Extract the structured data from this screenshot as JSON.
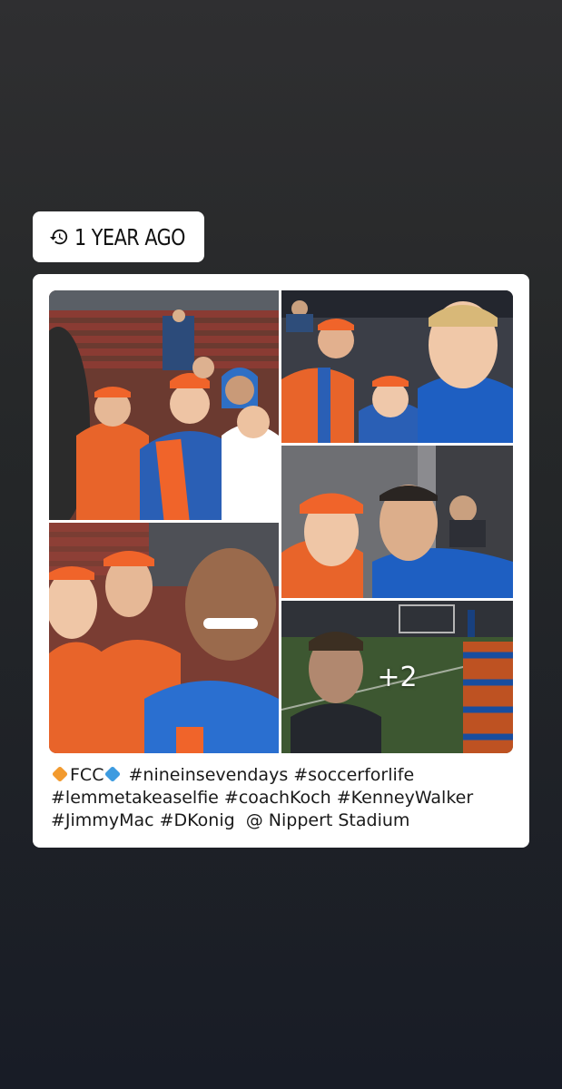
{
  "memory": {
    "label": "1 YEAR AGO",
    "icon": "history-icon"
  },
  "post": {
    "extra_photos_label": "+2",
    "caption": {
      "line1_prefix": "",
      "line1_team": "FCC",
      "line1_rest": " #nineinsevendays #soccerforlife",
      "line2": "#lemmetakeaselfie #coachKoch #KenneyWalker",
      "line3": "#JimmyMac #DKonig  @ Nippert Stadium"
    },
    "emoji": {
      "orange_diamond": "orange-diamond-icon",
      "blue_diamond": "blue-diamond-icon"
    }
  },
  "colors": {
    "fc_orange": "#f0642a",
    "fc_blue": "#1b57b8",
    "card_bg": "#ffffff"
  }
}
